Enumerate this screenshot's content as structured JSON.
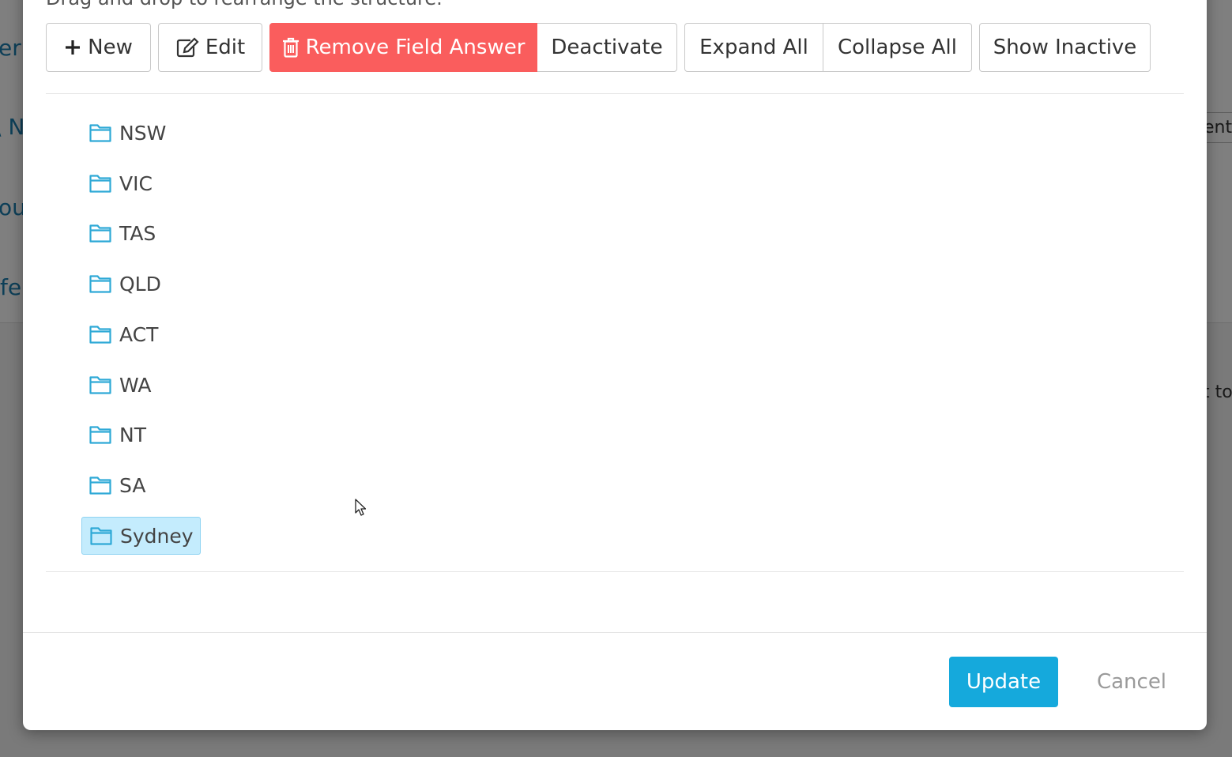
{
  "background": {
    "fragments": [
      "er",
      "\\ N",
      "ou",
      "fe",
      "ent",
      "t to"
    ]
  },
  "modal": {
    "hint": "Drag and drop to rearrange the structure.",
    "toolbar": {
      "new_label": "New",
      "edit_label": "Edit",
      "remove_label": "Remove Field Answer",
      "deactivate_label": "Deactivate",
      "expand_all_label": "Expand All",
      "collapse_all_label": "Collapse All",
      "show_inactive_label": "Show Inactive"
    },
    "tree": {
      "items": [
        {
          "label": "NSW",
          "selected": false
        },
        {
          "label": "VIC",
          "selected": false
        },
        {
          "label": "TAS",
          "selected": false
        },
        {
          "label": "QLD",
          "selected": false
        },
        {
          "label": "ACT",
          "selected": false
        },
        {
          "label": "WA",
          "selected": false
        },
        {
          "label": "NT",
          "selected": false
        },
        {
          "label": "SA",
          "selected": false
        },
        {
          "label": "Sydney",
          "selected": true
        }
      ]
    },
    "footer": {
      "update_label": "Update",
      "cancel_label": "Cancel"
    }
  },
  "colors": {
    "danger": "#fa5d5d",
    "primary": "#15a9dc",
    "folder_icon": "#2ea9d6",
    "selected_bg": "#c4ecfd"
  },
  "icons": {
    "new": "plus-icon",
    "edit": "edit-icon",
    "remove": "trash-icon",
    "tree_item": "folder-icon"
  }
}
